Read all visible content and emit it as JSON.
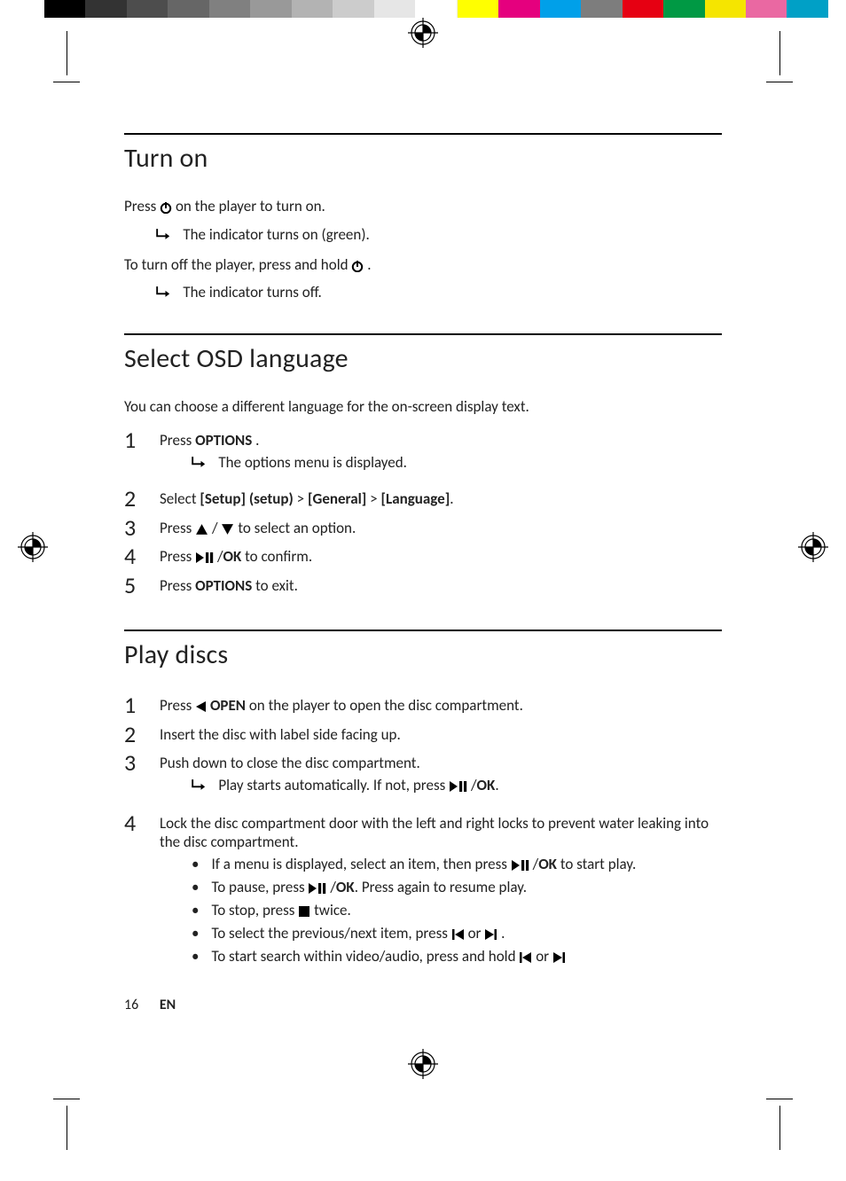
{
  "colorbar": [
    "#000000",
    "#333333",
    "#4d4d4d",
    "#666666",
    "#808080",
    "#999999",
    "#b3b3b3",
    "#cccccc",
    "#e6e6e6",
    "#ffffff",
    "#ffff00",
    "#e5007e",
    "#00a0e9",
    "#7d7d7d",
    "#e60012",
    "#009944",
    "#f5e500",
    "#ea68a2",
    "#00a0c6"
  ],
  "sections": {
    "turn_on": {
      "heading": "Turn on",
      "p1_a": "Press ",
      "p1_b": " on the player to turn on.",
      "r1": "The indicator turns on (green).",
      "p2_a": "To turn off the player, press and hold ",
      "p2_b": ".",
      "r2": "The indicator turns off."
    },
    "osd": {
      "heading": "Select OSD language",
      "intro": "You can choose a different language for the on-screen display text.",
      "steps": {
        "s1_a": "Press ",
        "s1_b": "OPTIONS",
        "s1_c": " .",
        "s1_r": "The options menu is displayed.",
        "s2_a": "Select ",
        "s2_b": "[Setup] (setup)",
        "s2_c": " > ",
        "s2_d": "[General]",
        "s2_e": " > ",
        "s2_f": "[Language]",
        "s2_g": ".",
        "s3_a": "Press ",
        "s3_b": " / ",
        "s3_c": " to select an option.",
        "s4_a": "Press ",
        "s4_b": " /",
        "s4_c": "OK",
        "s4_d": " to confirm.",
        "s5_a": "Press ",
        "s5_b": "OPTIONS",
        "s5_c": " to exit."
      }
    },
    "play": {
      "heading": "Play discs",
      "steps": {
        "s1_a": "Press ",
        "s1_b": " OPEN",
        "s1_c": " on the player to open the disc compartment.",
        "s2": "Insert the disc with label side facing up.",
        "s3": "Push down to close the disc compartment.",
        "s3_r_a": "Play starts automatically. If not, press ",
        "s3_r_b": " /",
        "s3_r_c": "OK",
        "s3_r_d": ".",
        "s4": "Lock the disc compartment door with the left and right locks to prevent water leaking into the disc compartment.",
        "b1_a": "If a menu is displayed, select an item, then press ",
        "b1_b": " /",
        "b1_c": "OK",
        "b1_d": " to start play.",
        "b2_a": "To pause, press ",
        "b2_b": " /",
        "b2_c": "OK",
        "b2_d": ". Press again to resume play.",
        "b3_a": "To stop, press ",
        "b3_b": " twice.",
        "b4_a": "To select the previous/next item, press ",
        "b4_b": " or ",
        "b4_c": ".",
        "b5_a": "To start search within video/audio, press and hold ",
        "b5_b": " or "
      }
    }
  },
  "footer": {
    "page": "16",
    "lang": "EN"
  },
  "icons": {
    "power": "power-icon",
    "result_arrow": "result-arrow-icon",
    "up": "triangle-up-icon",
    "down": "triangle-down-icon",
    "left": "triangle-left-icon",
    "play_pause": "play-pause-icon",
    "stop": "stop-icon",
    "prev": "prev-track-icon",
    "next": "next-track-icon",
    "registration": "registration-mark-icon"
  }
}
